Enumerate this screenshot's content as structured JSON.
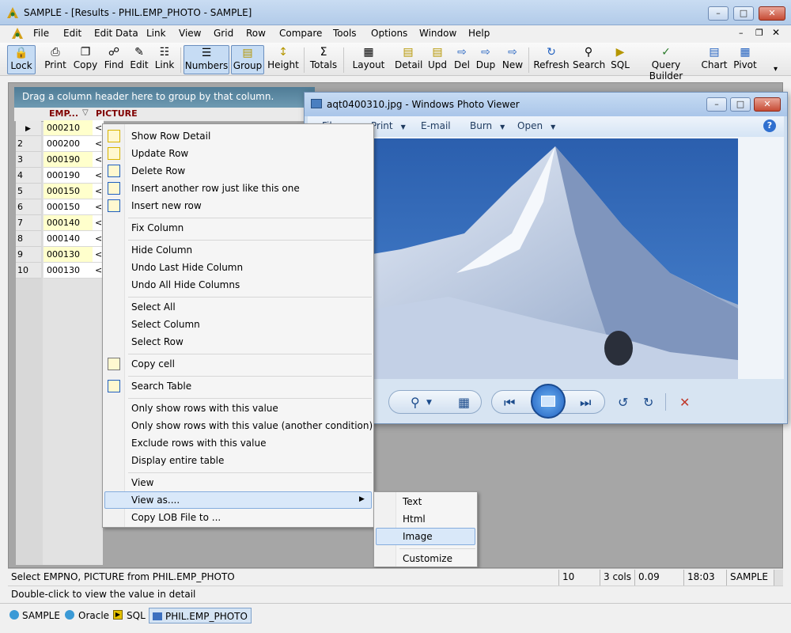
{
  "window": {
    "title": "SAMPLE - [Results - PHIL.EMP_PHOTO - SAMPLE]"
  },
  "menubar": [
    "File",
    "Edit",
    "Edit Data",
    "Link",
    "View",
    "Grid",
    "Row",
    "Compare",
    "Tools",
    "Options",
    "Window",
    "Help"
  ],
  "toolbar": [
    "Lock",
    "Print",
    "Copy",
    "Find",
    "Edit",
    "Link",
    "Numbers",
    "Group",
    "Height",
    "Totals",
    "Layout",
    "Detail",
    "Upd",
    "Del",
    "Dup",
    "New",
    "Refresh",
    "Search",
    "SQL",
    "Query Builder",
    "Chart",
    "Pivot"
  ],
  "grid": {
    "group_hint": "Drag a column header here to group by that column.",
    "columns": [
      "EMP...",
      "PICTURE"
    ],
    "rows": [
      {
        "n": "",
        "empno": "000210"
      },
      {
        "n": "2",
        "empno": "000200"
      },
      {
        "n": "3",
        "empno": "000190"
      },
      {
        "n": "4",
        "empno": "000190"
      },
      {
        "n": "5",
        "empno": "000150"
      },
      {
        "n": "6",
        "empno": "000150"
      },
      {
        "n": "7",
        "empno": "000140"
      },
      {
        "n": "8",
        "empno": "000140"
      },
      {
        "n": "9",
        "empno": "000130"
      },
      {
        "n": "10",
        "empno": "000130"
      }
    ],
    "cell_prefix": "<"
  },
  "context_menu": {
    "items": [
      "Show Row Detail",
      "Update Row",
      "Delete Row",
      "Insert another row just like this one",
      "Insert new row",
      "Fix Column",
      "Hide Column",
      "Undo Last Hide Column",
      "Undo All Hide Columns",
      "Select All",
      "Select Column",
      "Select Row",
      "Copy cell",
      "Search Table",
      "Only show rows with this value",
      "Only show rows with this value (another condition)",
      "Exclude rows with this value",
      "Display entire table",
      "View",
      "View as....",
      "Copy LOB File to ..."
    ]
  },
  "submenu": {
    "items": [
      "Text",
      "Html",
      "Image",
      "Customize"
    ]
  },
  "photo_viewer": {
    "title": "aqt0400310.jpg - Windows Photo Viewer",
    "menu": [
      "File",
      "Print",
      "E-mail",
      "Burn",
      "Open"
    ]
  },
  "status": {
    "sql": "Select EMPNO, PICTURE from PHIL.EMP_PHOTO",
    "rows": "10 rows",
    "cols": "3 cols",
    "time": "0.09 secs",
    "clock": "18:03 p.m.",
    "db": "SAMPLE",
    "hint": "Double-click to view the value in detail"
  },
  "tabs": [
    "SAMPLE",
    "Oracle",
    "SQL",
    "PHIL.EMP_PHOTO"
  ]
}
